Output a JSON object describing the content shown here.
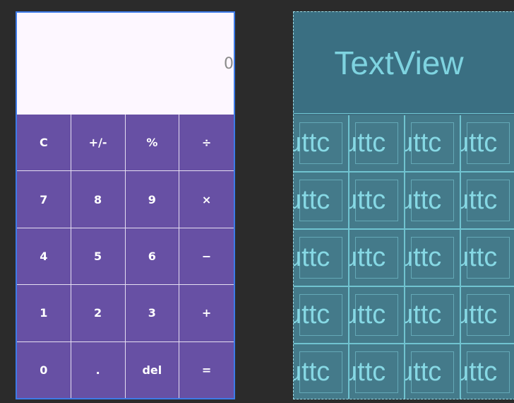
{
  "design": {
    "display": {
      "value": "0"
    },
    "keys": [
      "C",
      "+/-",
      "%",
      "÷",
      "7",
      "8",
      "9",
      "×",
      "4",
      "5",
      "6",
      "−",
      "1",
      "2",
      "3",
      "+",
      "0",
      ".",
      "del",
      "="
    ]
  },
  "blueprint": {
    "text_view_label": "TextView",
    "button_label": "uttc"
  },
  "colors": {
    "accent": "#6750a4",
    "display_bg": "#fdf7ff",
    "blueprint_bg": "#3f6f80",
    "blueprint_text": "#7ed3e0",
    "selection": "#3d7be8"
  }
}
